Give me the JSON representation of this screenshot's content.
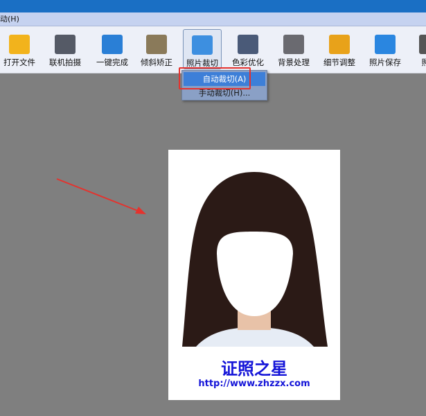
{
  "menubar": {
    "item": "动(H)"
  },
  "toolbar": {
    "items": [
      {
        "label": "打开文件",
        "icon": "folder-icon",
        "color": "#f2b31c"
      },
      {
        "label": "联机拍摄",
        "icon": "camera-icon",
        "color": "#555a66"
      },
      {
        "label": "一键完成",
        "icon": "one-click-icon",
        "color": "#2a7fd6"
      },
      {
        "label": "倾斜矫正",
        "icon": "tilt-correct-icon",
        "color": "#8a7a5a"
      },
      {
        "label": "照片裁切",
        "icon": "crop-icon",
        "color": "#3d8fe0"
      },
      {
        "label": "色彩优化",
        "icon": "color-optimize-icon",
        "color": "#4a5a78"
      },
      {
        "label": "背景处理",
        "icon": "background-icon",
        "color": "#6a6a70"
      },
      {
        "label": "细节调整",
        "icon": "detail-adjust-icon",
        "color": "#e8a21a"
      },
      {
        "label": "照片保存",
        "icon": "save-icon",
        "color": "#2a86e0"
      },
      {
        "label": "照片",
        "icon": "print-icon",
        "color": "#555"
      }
    ]
  },
  "dropdown": {
    "items": [
      "自动裁切(A)",
      "手动裁切(H)..."
    ]
  },
  "photo": {
    "brand": "证照之星",
    "url": "http://www.zhzzx.com"
  }
}
